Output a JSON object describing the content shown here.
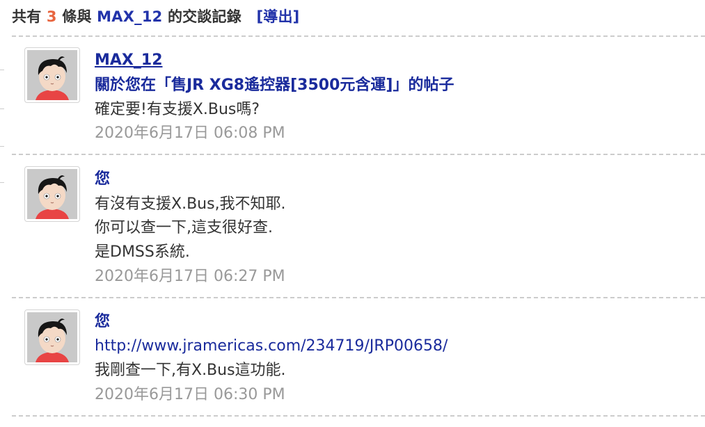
{
  "header": {
    "prefix": "共有",
    "count": "3",
    "middle": "條與",
    "username": "MAX_12",
    "suffix": "的交談記錄",
    "export_label": "[導出]"
  },
  "messages": [
    {
      "sender": "MAX_12",
      "subject": "關於您在「售JR XG8遙控器[3500元含運]」的帖子",
      "lines": [
        "確定要!有支援X.Bus嗎?"
      ],
      "time": "2020年6月17日 06:08 PM"
    },
    {
      "sender": "您",
      "lines": [
        "有沒有支援X.Bus,我不知耶.",
        "你可以查一下,這支很好查.",
        "是DMSS系統."
      ],
      "time": "2020年6月17日 06:27 PM"
    },
    {
      "sender": "您",
      "url": "http://www.jramericas.com/234719/JRP00658/",
      "lines": [
        "我剛查一下,有X.Bus這功能."
      ],
      "time": "2020年6月17日 06:30 PM"
    }
  ],
  "icons": {
    "avatar": "avatar-icon"
  },
  "colors": {
    "link": "#1a2b9c",
    "count": "#e8653f",
    "time": "#999999",
    "text": "#333333"
  }
}
